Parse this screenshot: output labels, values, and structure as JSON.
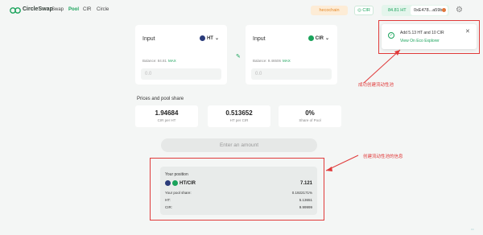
{
  "nav": {
    "brand": "CircleSwap",
    "links": [
      "Swap",
      "Pool",
      "CIR",
      "Circle"
    ],
    "active_link": "Pool",
    "network": "hecochain",
    "cir_button": "CIR",
    "balance": "84.81 HT",
    "address": "0xE478...a59b"
  },
  "inputs": [
    {
      "label": "Input",
      "token": "HT",
      "balance": "Balance: 84.81",
      "max": "MAX",
      "amount_placeholder": "0.0",
      "icon_color": "#2a3b7a"
    },
    {
      "label": "Input",
      "token": "CIR",
      "balance": "Balance: 9.46506",
      "max": "MAX",
      "amount_placeholder": "0.0",
      "icon_color": "#1aa35b"
    }
  ],
  "prices": {
    "title": "Prices and pool share",
    "stats": [
      {
        "value": "1.94684",
        "caption": "CIR per HT"
      },
      {
        "value": "0.513652",
        "caption": "HT per CIR"
      },
      {
        "value": "0%",
        "caption": "Share of Pool"
      }
    ]
  },
  "enter_button": "Enter an amount",
  "position": {
    "title": "Your position",
    "pair": "HT/CIR",
    "pair_value": "7.121",
    "rows": [
      {
        "label": "Your pool share:",
        "value": "0.1922171%"
      },
      {
        "label": "HT:",
        "value": "5.13651"
      },
      {
        "label": "CIR:",
        "value": "9.99999"
      }
    ]
  },
  "toast": {
    "message": "Add 5.13 HT and 10 CIR",
    "link": "View On Eco Explorer"
  },
  "annotations": {
    "success_note": "成功创建流动性池",
    "info_note": "创建流动性池的信息"
  },
  "colors": {
    "accent": "#1aa35b",
    "annotation": "#e03a3a"
  }
}
